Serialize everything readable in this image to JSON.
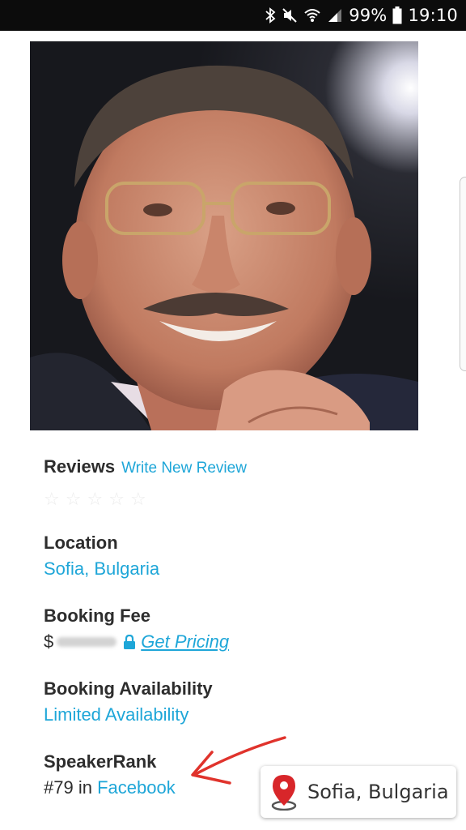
{
  "status_bar": {
    "battery": "99%",
    "time": "19:10"
  },
  "profile": {
    "reviews_heading": "Reviews",
    "write_review_link": "Write New Review",
    "rating_stars": 5,
    "location_heading": "Location",
    "location_value": "Sofia, Bulgaria",
    "booking_fee_heading": "Booking Fee",
    "fee_currency": "$",
    "get_pricing_link": "Get Pricing",
    "availability_heading": "Booking Availability",
    "availability_value": "Limited Availability",
    "speakerrank_heading": "SpeakerRank",
    "rank_prefix": "#79 in",
    "rank_category": "Facebook"
  },
  "location_chip": {
    "label": "Sofia, Bulgaria"
  },
  "colors": {
    "link": "#1ea6d8",
    "annotation_arrow": "#e0332c",
    "pin": "#d8262a"
  },
  "icons": [
    "bluetooth-icon",
    "mute-icon",
    "wifi-icon",
    "signal-icon",
    "battery-icon",
    "lock-icon",
    "map-pin-icon",
    "star-icon"
  ]
}
